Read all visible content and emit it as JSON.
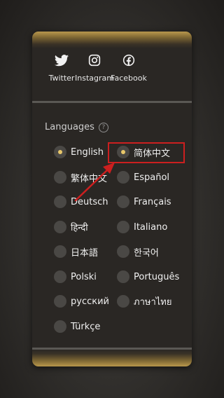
{
  "social": {
    "twitter": "Twitter",
    "instagram": "Instagram",
    "facebook": "Facebook"
  },
  "languages": {
    "title": "Languages",
    "help_symbol": "?",
    "options": [
      {
        "label": "English",
        "selected": true
      },
      {
        "label": "简体中文",
        "selected": true
      },
      {
        "label": "繁体中文",
        "selected": false
      },
      {
        "label": "Español",
        "selected": false
      },
      {
        "label": "Deutsch",
        "selected": false
      },
      {
        "label": "Français",
        "selected": false
      },
      {
        "label": "हिन्दी",
        "selected": false
      },
      {
        "label": "Italiano",
        "selected": false
      },
      {
        "label": "日本語",
        "selected": false
      },
      {
        "label": "한국어",
        "selected": false
      },
      {
        "label": "Polski",
        "selected": false
      },
      {
        "label": "Português",
        "selected": false
      },
      {
        "label": "русский",
        "selected": false
      },
      {
        "label": "ภาษาไทย",
        "selected": false
      },
      {
        "label": "Türkçe",
        "selected": false
      }
    ]
  },
  "colors": {
    "accent_gold": "#e9c86a",
    "highlight_red": "#cc1f1f"
  }
}
